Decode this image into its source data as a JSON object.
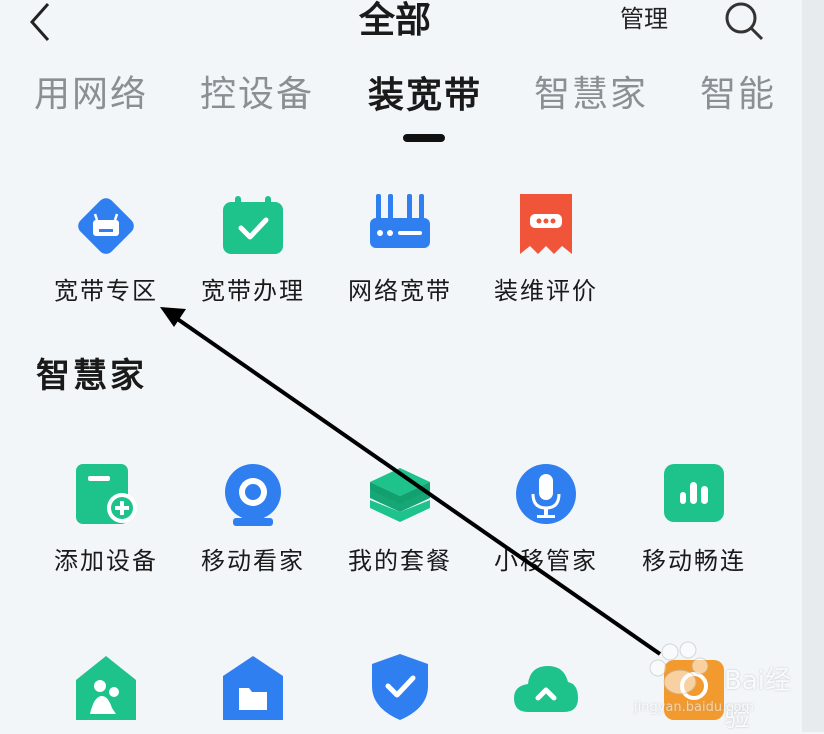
{
  "header": {
    "title": "全部",
    "manage_label": "管理"
  },
  "tabs": [
    {
      "label": "用网络"
    },
    {
      "label": "控设备"
    },
    {
      "label": "装宽带"
    },
    {
      "label": "智慧家"
    },
    {
      "label": "智能"
    }
  ],
  "broadband_apps": [
    {
      "label": "宽带专区",
      "icon": "router-icon"
    },
    {
      "label": "宽带办理",
      "icon": "calendar-check-icon"
    },
    {
      "label": "网络宽带",
      "icon": "router-antenna-icon"
    },
    {
      "label": "装维评价",
      "icon": "rating-message-icon"
    }
  ],
  "section_title": "智慧家",
  "smart_home_apps": [
    {
      "label": "添加设备",
      "icon": "add-device-icon"
    },
    {
      "label": "移动看家",
      "icon": "camera-icon"
    },
    {
      "label": "我的套餐",
      "icon": "layers-icon"
    },
    {
      "label": "小移管家",
      "icon": "microphone-icon"
    },
    {
      "label": "移动畅连",
      "icon": "chat-icon"
    }
  ],
  "bottom_apps": [
    {
      "icon": "family-home-icon"
    },
    {
      "icon": "folder-home-icon"
    },
    {
      "icon": "shield-check-icon"
    },
    {
      "icon": "cloud-upload-icon"
    },
    {
      "icon": "orange-app-icon"
    }
  ],
  "watermark": {
    "text": "Bai经验",
    "url": "jingyan.baidu.com"
  },
  "colors": {
    "green": "#1ec28b",
    "blue": "#2f7ff0",
    "orange_red": "#f0553a",
    "bg": "#f3f6f9"
  }
}
